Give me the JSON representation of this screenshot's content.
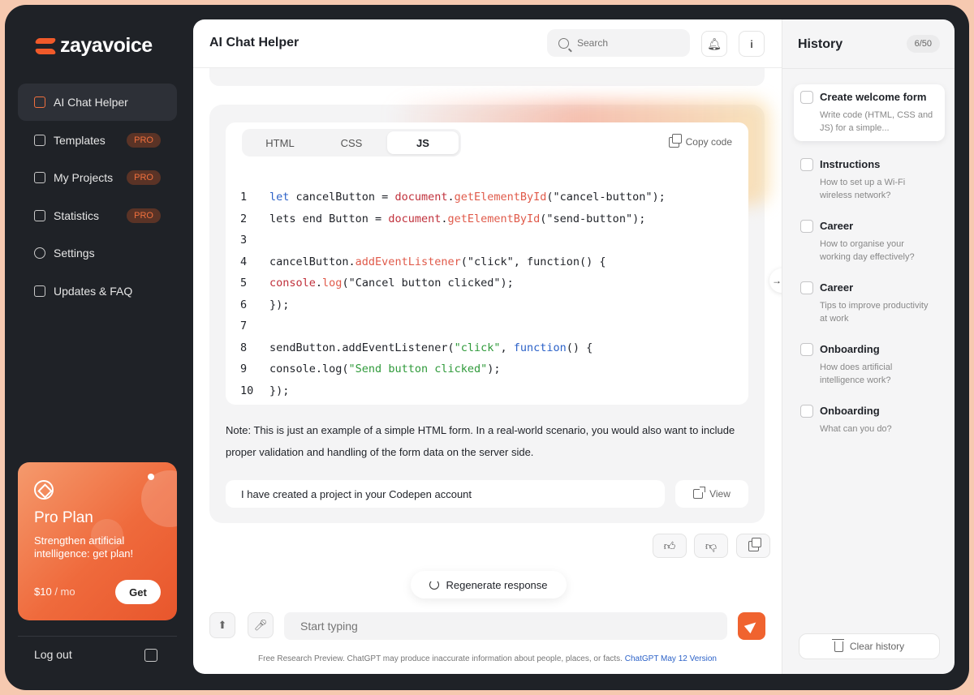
{
  "brand": {
    "name": "zayavoice",
    "accent": "#f0632f"
  },
  "sidebar": {
    "items": [
      {
        "label": "AI Chat Helper",
        "active": true,
        "pro": false,
        "icon": "chat-icon"
      },
      {
        "label": "Templates",
        "pro": true,
        "icon": "document-icon"
      },
      {
        "label": "My Projects",
        "pro": true,
        "icon": "grid-icon"
      },
      {
        "label": "Statistics",
        "pro": true,
        "icon": "chart-icon"
      },
      {
        "label": "Settings",
        "pro": false,
        "icon": "gear-icon"
      },
      {
        "label": "Updates & FAQ",
        "pro": false,
        "icon": "help-icon"
      }
    ],
    "pro_badge": "PRO",
    "plan": {
      "title": "Pro Plan",
      "description": "Strengthen artificial intelligence: get plan!",
      "price": "$10",
      "unit": " / mo",
      "cta": "Get"
    },
    "logout": "Log out"
  },
  "header": {
    "title": "AI Chat Helper",
    "search_placeholder": "Search"
  },
  "code_panel": {
    "tabs": [
      "HTML",
      "CSS",
      "JS"
    ],
    "active_tab": "JS",
    "copy_label": "Copy code",
    "line_numbers": [
      "1",
      "2",
      "3",
      "4",
      "5",
      "6",
      "7",
      "8",
      "9",
      "10"
    ]
  },
  "note": "Note: This is just an example of a simple HTML form. In a real-world scenario, you would also want to include proper validation and handling of the form data on the server side.",
  "project": {
    "message": "I have created a project in your Codepen account",
    "view_label": "View"
  },
  "regenerate_label": "Regenerate response",
  "composer": {
    "placeholder": "Start typing"
  },
  "disclaimer": {
    "text": "Free Research Preview. ChatGPT may produce inaccurate information about people, places, or facts.",
    "link": "ChatGPT May 12 Version"
  },
  "history": {
    "title": "History",
    "count": "6/50",
    "items": [
      {
        "title": "Create welcome form",
        "subtitle": "Write code (HTML, CSS and JS) for a simple...",
        "active": true
      },
      {
        "title": "Instructions",
        "subtitle": "How to set up a Wi-Fi wireless network?"
      },
      {
        "title": "Career",
        "subtitle": "How to organise your working day effectively?"
      },
      {
        "title": "Career",
        "subtitle": "Tips to improve productivity at work"
      },
      {
        "title": "Onboarding",
        "subtitle": "How does artificial intelligence work?"
      },
      {
        "title": "Onboarding",
        "subtitle": "What can you do?"
      }
    ],
    "clear_label": "Clear history"
  }
}
